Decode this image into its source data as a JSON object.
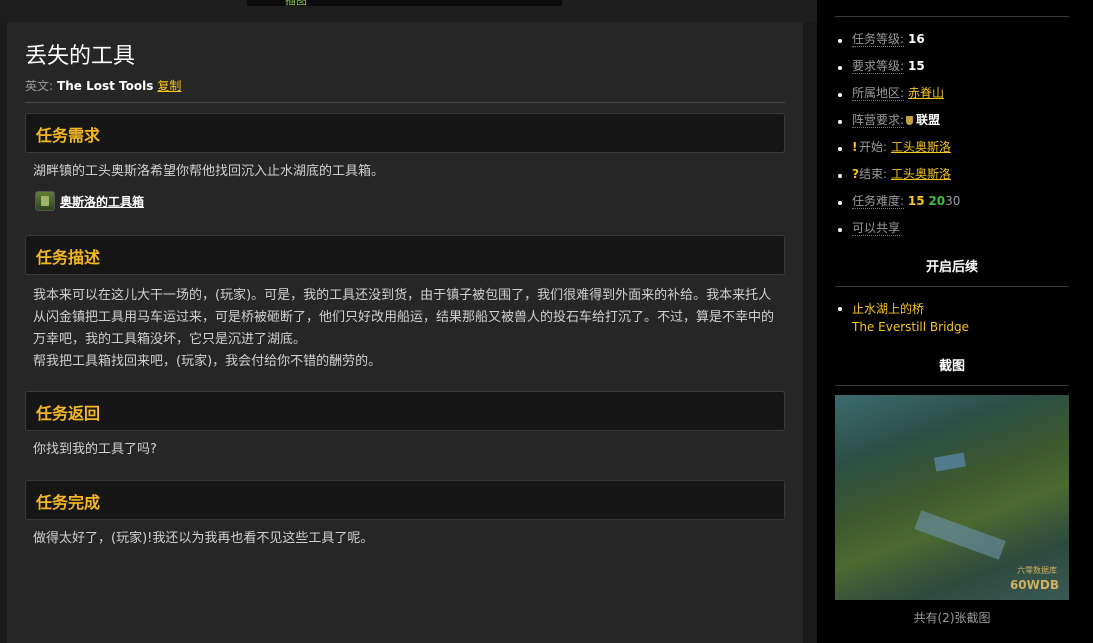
{
  "topbar": {
    "tab_label": "插图"
  },
  "quest": {
    "title": "丢失的工具",
    "en_prefix": "英文:",
    "en_name": "The Lost Tools",
    "copy_label": "复制"
  },
  "sections": {
    "requirements": {
      "header": "任务需求",
      "text": "湖畔镇的工头奥斯洛希望你帮他找回沉入止水湖底的工具箱。",
      "item": {
        "name": "奥斯洛的工具箱",
        "icon": "toolbox-icon"
      }
    },
    "description": {
      "header": "任务描述",
      "p1": "我本来可以在这儿大干一场的，(玩家)。可是，我的工具还没到货，由于镇子被包围了，我们很难得到外面来的补给。我本来托人从闪金镇把工具用马车运过来，可是桥被砸断了，他们只好改用船运，结果那船又被兽人的投石车给打沉了。不过，算是不幸中的万幸吧，我的工具箱没坏，它只是沉进了湖底。",
      "p2": "帮我把工具箱找回来吧，(玩家)，我会付给你不错的酬劳的。"
    },
    "return": {
      "header": "任务返回",
      "text": "你找到我的工具了吗?"
    },
    "complete": {
      "header": "任务完成",
      "text": "做得太好了，(玩家)!我还以为我再也看不见这些工具了呢。"
    }
  },
  "sidebar": {
    "quest_level": {
      "key": "任务等级:",
      "value": "16"
    },
    "req_level": {
      "key": "要求等级:",
      "value": "15"
    },
    "zone": {
      "key": "所属地区:",
      "value": "赤脊山"
    },
    "faction": {
      "key": "阵营要求:",
      "value": "联盟"
    },
    "start": {
      "key": "开始:",
      "value": "工头奥斯洛",
      "marker": "!"
    },
    "end": {
      "key": "结束:",
      "value": "工头奥斯洛",
      "marker": "?"
    },
    "difficulty": {
      "key": "任务难度:",
      "yellow": "15",
      "green": "20",
      "gray": "30"
    },
    "shareable": "可以共享",
    "followup_header": "开启后续",
    "followup": {
      "zh": "止水湖上的桥",
      "en": "The Everstill Bridge"
    },
    "screenshot_header": "截图",
    "screenshot_watermark_small": "六零数据库",
    "screenshot_watermark": "60WDB",
    "screenshot_caption": "共有(2)张截图"
  },
  "colors": {
    "accent": "#f5b820",
    "link": "#f5c518",
    "green": "#3fbf3f"
  }
}
